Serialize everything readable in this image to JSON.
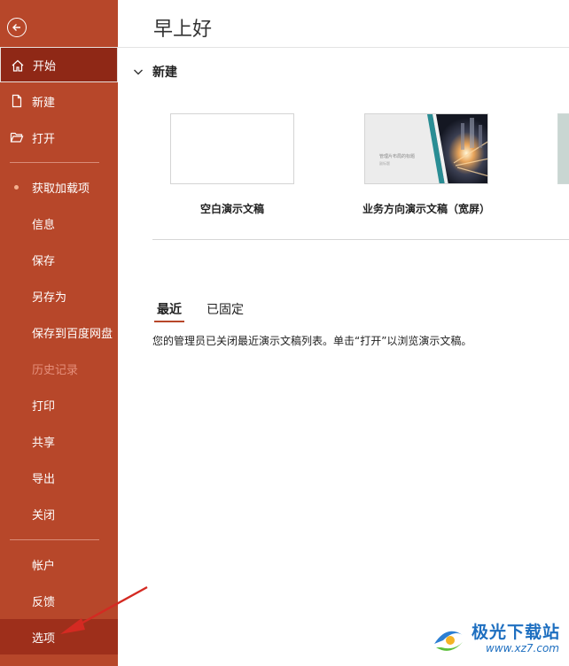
{
  "sidebar": {
    "items": [
      {
        "key": "home",
        "label": "开始",
        "icon": "home-icon"
      },
      {
        "key": "new",
        "label": "新建",
        "icon": "new-file-icon"
      },
      {
        "key": "open",
        "label": "打开",
        "icon": "folder-open-icon"
      },
      {
        "key": "addins",
        "label": "获取加载项"
      },
      {
        "key": "info",
        "label": "信息"
      },
      {
        "key": "save",
        "label": "保存"
      },
      {
        "key": "saveas",
        "label": "另存为"
      },
      {
        "key": "savecloud",
        "label": "保存到百度网盘"
      },
      {
        "key": "history",
        "label": "历史记录"
      },
      {
        "key": "print",
        "label": "打印"
      },
      {
        "key": "share",
        "label": "共享"
      },
      {
        "key": "export",
        "label": "导出"
      },
      {
        "key": "close",
        "label": "关闭"
      },
      {
        "key": "account",
        "label": "帐户"
      },
      {
        "key": "feedback",
        "label": "反馈"
      },
      {
        "key": "options",
        "label": "选项"
      }
    ]
  },
  "main": {
    "greeting": "早上好",
    "new_section": "新建",
    "templates": [
      {
        "caption": "空白演示文稿"
      },
      {
        "caption": "业务方向演示文稿（宽屏）",
        "thumb_title": "管理片布局的标题",
        "thumb_sub": "副标题"
      }
    ],
    "tabs": [
      "最近",
      "已固定"
    ],
    "notice": "您的管理员已关闭最近演示文稿列表。单击“打开”以浏览演示文稿。"
  },
  "watermark": {
    "title": "极光下载站",
    "url": "www.xz7.com"
  },
  "colors": {
    "sidebar": "#b7472a",
    "active": "#8f2816",
    "accent": "#b7472a"
  }
}
